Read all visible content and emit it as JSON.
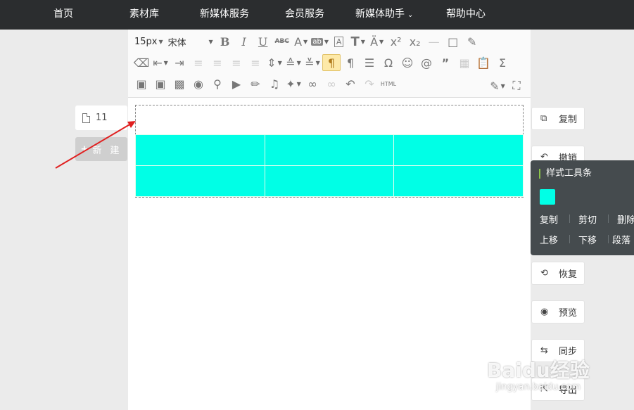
{
  "nav": {
    "items": [
      "首页",
      "素材库",
      "新媒体服务",
      "会员服务",
      "新媒体助手",
      "帮助中心"
    ]
  },
  "left": {
    "doc_count": "11",
    "new_label": "新 建"
  },
  "toolbar": {
    "font_size": "15px",
    "font_family": "宋体"
  },
  "table": {
    "color": "#00ffe6"
  },
  "right_actions": {
    "copy": "复制",
    "undo": "撤销",
    "restore": "恢复",
    "preview": "预览",
    "sync": "同步",
    "export": "导出"
  },
  "style_toolbar": {
    "title": "样式工具条",
    "ops_row1": [
      "复制",
      "剪切",
      "删除"
    ],
    "ops_row2": [
      "上移",
      "下移",
      "段落"
    ],
    "swatch_color": "#00ffe6"
  },
  "watermark": {
    "brand": "Baidu经验",
    "url": "jingyan.baidu.com"
  }
}
